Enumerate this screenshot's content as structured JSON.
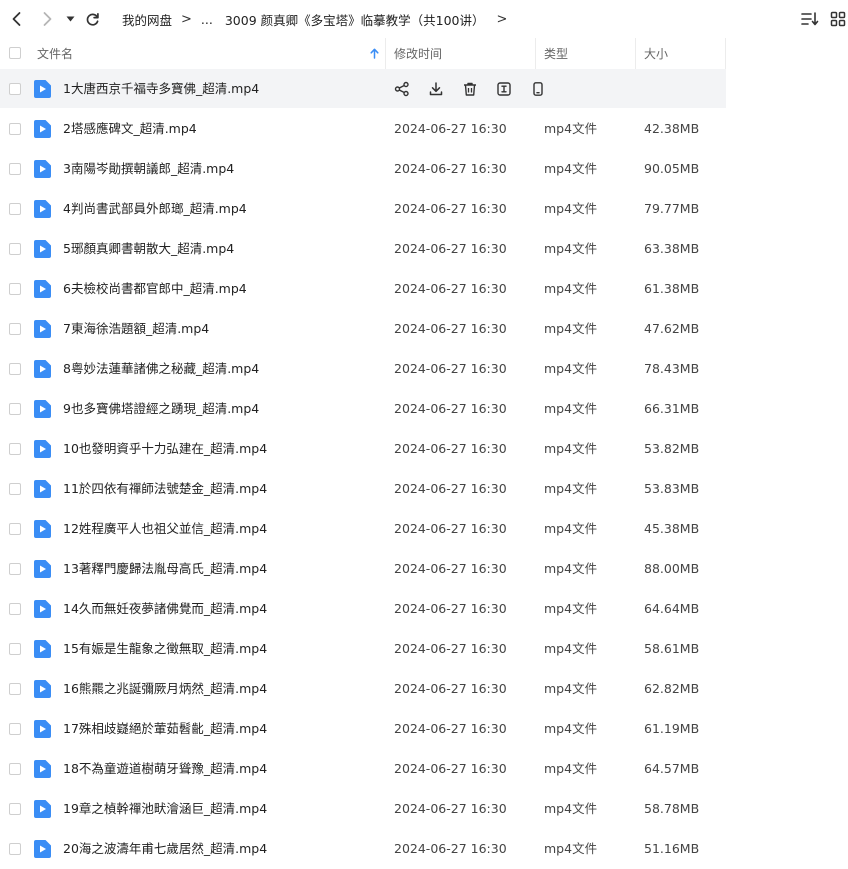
{
  "breadcrumb": {
    "root": "我的网盘",
    "ellipsis": "...",
    "current": "3009 颜真卿《多宝塔》临摹教学（共100讲）"
  },
  "columns": {
    "name": "文件名",
    "modified": "修改时间",
    "type": "类型",
    "size": "大小"
  },
  "sort": {
    "column": "name",
    "direction": "ascending"
  },
  "colors": {
    "file_icon": "#3a8df5",
    "sort_arrow": "#3a8df5",
    "hover_row": "#f3f4f6"
  },
  "row_actions": [
    "share-icon",
    "download-icon",
    "delete-icon",
    "rename-icon",
    "phone-icon"
  ],
  "files": [
    {
      "name": "1大唐西京千福寺多寶佛_超清.mp4",
      "modified": "",
      "type": "",
      "size": "",
      "hovered": true
    },
    {
      "name": "2塔感應碑文_超清.mp4",
      "modified": "2024-06-27 16:30",
      "type": "mp4文件",
      "size": "42.38MB"
    },
    {
      "name": "3南陽岑勛撰朝議郎_超清.mp4",
      "modified": "2024-06-27 16:30",
      "type": "mp4文件",
      "size": "90.05MB"
    },
    {
      "name": "4判尚書武部員外郎瑯_超清.mp4",
      "modified": "2024-06-27 16:30",
      "type": "mp4文件",
      "size": "79.77MB"
    },
    {
      "name": "5琊顏真卿書朝散大_超清.mp4",
      "modified": "2024-06-27 16:30",
      "type": "mp4文件",
      "size": "63.38MB"
    },
    {
      "name": "6夫檢校尚書都官郎中_超清.mp4",
      "modified": "2024-06-27 16:30",
      "type": "mp4文件",
      "size": "61.38MB"
    },
    {
      "name": "7東海徐浩題額_超清.mp4",
      "modified": "2024-06-27 16:30",
      "type": "mp4文件",
      "size": "47.62MB"
    },
    {
      "name": "8粤妙法蓮華諸佛之秘藏_超清.mp4",
      "modified": "2024-06-27 16:30",
      "type": "mp4文件",
      "size": "78.43MB"
    },
    {
      "name": "9也多寶佛塔證經之踴現_超清.mp4",
      "modified": "2024-06-27 16:30",
      "type": "mp4文件",
      "size": "66.31MB"
    },
    {
      "name": "10也發明資乎十力弘建在_超清.mp4",
      "modified": "2024-06-27 16:30",
      "type": "mp4文件",
      "size": "53.82MB"
    },
    {
      "name": "11於四依有禪師法號楚金_超清.mp4",
      "modified": "2024-06-27 16:30",
      "type": "mp4文件",
      "size": "53.83MB"
    },
    {
      "name": "12姓程廣平人也祖父並信_超清.mp4",
      "modified": "2024-06-27 16:30",
      "type": "mp4文件",
      "size": "45.38MB"
    },
    {
      "name": "13著釋門慶歸法胤母高氏_超清.mp4",
      "modified": "2024-06-27 16:30",
      "type": "mp4文件",
      "size": "88.00MB"
    },
    {
      "name": "14久而無妊夜夢諸佛覺而_超清.mp4",
      "modified": "2024-06-27 16:30",
      "type": "mp4文件",
      "size": "64.64MB"
    },
    {
      "name": "15有娠是生龍象之徵無取_超清.mp4",
      "modified": "2024-06-27 16:30",
      "type": "mp4文件",
      "size": "58.61MB"
    },
    {
      "name": "16熊羆之兆誕彌厥月炳然_超清.mp4",
      "modified": "2024-06-27 16:30",
      "type": "mp4文件",
      "size": "62.82MB"
    },
    {
      "name": "17殊相歧嶷絕於葷茹髫齔_超清.mp4",
      "modified": "2024-06-27 16:30",
      "type": "mp4文件",
      "size": "61.19MB"
    },
    {
      "name": "18不為童遊道樹萌牙聳豫_超清.mp4",
      "modified": "2024-06-27 16:30",
      "type": "mp4文件",
      "size": "64.57MB"
    },
    {
      "name": "19章之楨幹禪池畎澮涵巨_超清.mp4",
      "modified": "2024-06-27 16:30",
      "type": "mp4文件",
      "size": "58.78MB"
    },
    {
      "name": "20海之波濤年甫七歲居然_超清.mp4",
      "modified": "2024-06-27 16:30",
      "type": "mp4文件",
      "size": "51.16MB"
    }
  ]
}
